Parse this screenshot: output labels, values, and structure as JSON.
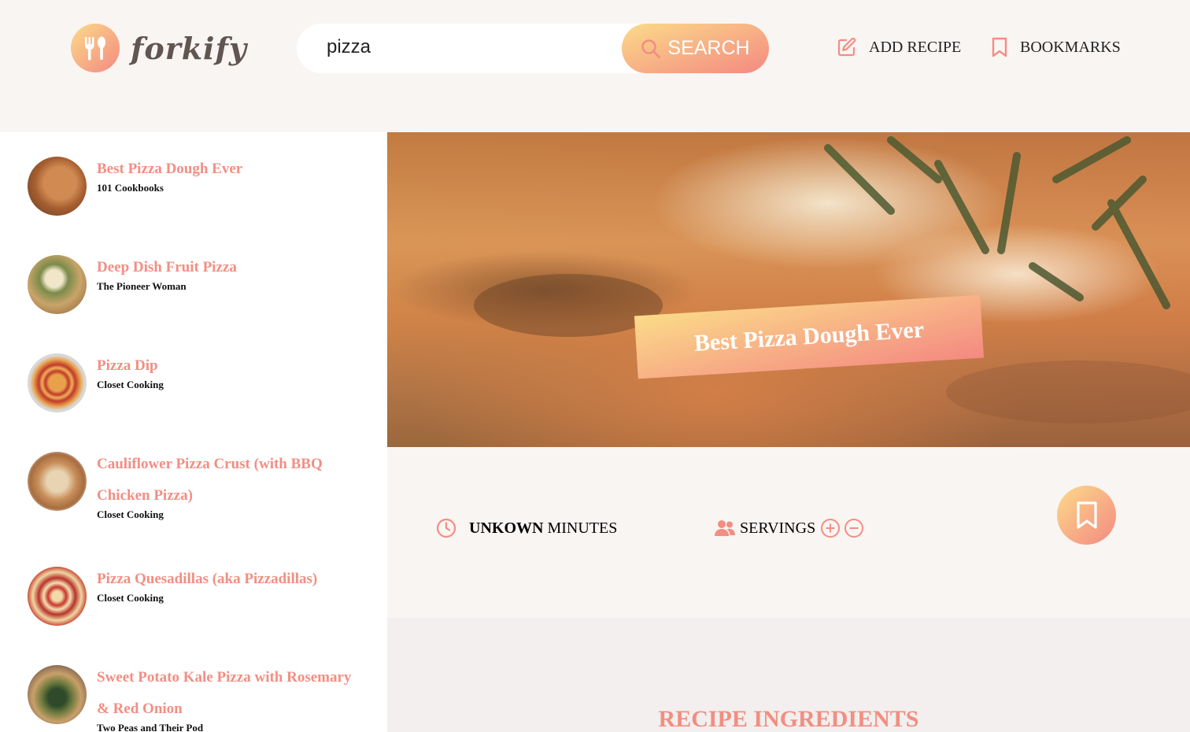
{
  "header": {
    "logo_text": "forkify",
    "search": {
      "value": "pizza",
      "button_label": "SEARCH"
    },
    "nav": {
      "add_recipe": "ADD RECIPE",
      "bookmarks": "BOOKMARKS"
    }
  },
  "results": [
    {
      "title": "Best Pizza Dough Ever",
      "publisher": "101 Cookbooks"
    },
    {
      "title": "Deep Dish Fruit Pizza",
      "publisher": "The Pioneer Woman"
    },
    {
      "title": "Pizza Dip",
      "publisher": "Closet Cooking"
    },
    {
      "title": "Cauliflower Pizza Crust (with BBQ Chicken Pizza)",
      "publisher": "Closet Cooking"
    },
    {
      "title": "Pizza Quesadillas (aka Pizzadillas)",
      "publisher": "Closet Cooking"
    },
    {
      "title": "Sweet Potato Kale Pizza with Rosemary & Red Onion",
      "publisher": "Two Peas and Their Pod"
    }
  ],
  "recipe": {
    "title": "Best Pizza Dough Ever",
    "time_value": "UNKOWN",
    "time_unit": "MINUTES",
    "servings_label": "SERVINGS",
    "ingredients_heading": "RECIPE INGREDIENTS"
  },
  "colors": {
    "accent_start": "#fbdb89",
    "accent_end": "#f48982",
    "title": "#f38e82"
  },
  "icons": [
    "logo-icon",
    "search-icon",
    "edit-icon",
    "bookmark-icon",
    "clock-icon",
    "users-icon",
    "plus-circle-icon",
    "minus-circle-icon"
  ]
}
